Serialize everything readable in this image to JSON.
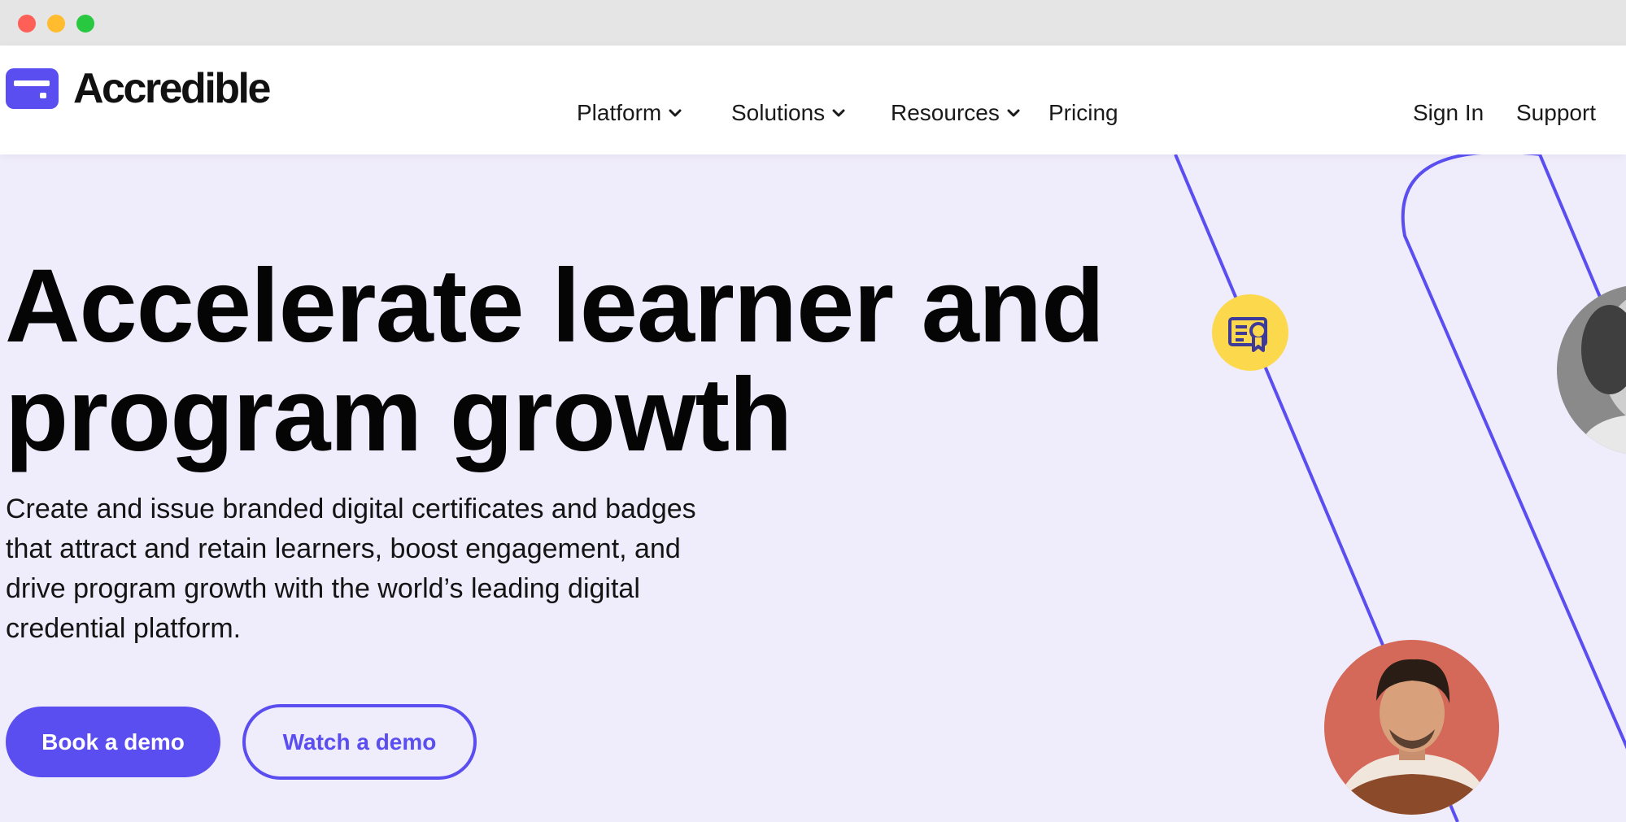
{
  "brand": {
    "name": "Accredible",
    "accent": "#5a4ef0",
    "badge_color": "#fcd94c",
    "background": "#efecfb"
  },
  "nav": {
    "items": [
      {
        "label": "Platform",
        "has_dropdown": true
      },
      {
        "label": "Solutions",
        "has_dropdown": true
      },
      {
        "label": "Resources",
        "has_dropdown": true
      },
      {
        "label": "Pricing",
        "has_dropdown": false
      }
    ],
    "sign_in": "Sign In",
    "support": "Support"
  },
  "hero": {
    "title_lines": [
      "Accelerate learner and",
      "program growth"
    ],
    "description_lines": [
      "Create and issue branded digital certificates and badges",
      "that attract and retain learners, boost engagement, and",
      "drive program growth with the world’s leading digital",
      "credential platform."
    ],
    "primary_cta": "Book a demo",
    "secondary_cta": "Watch a demo"
  },
  "icons": {
    "logo": "accredible-logo-icon",
    "dropdown": "chevron-down-icon",
    "certificate": "certificate-icon"
  }
}
